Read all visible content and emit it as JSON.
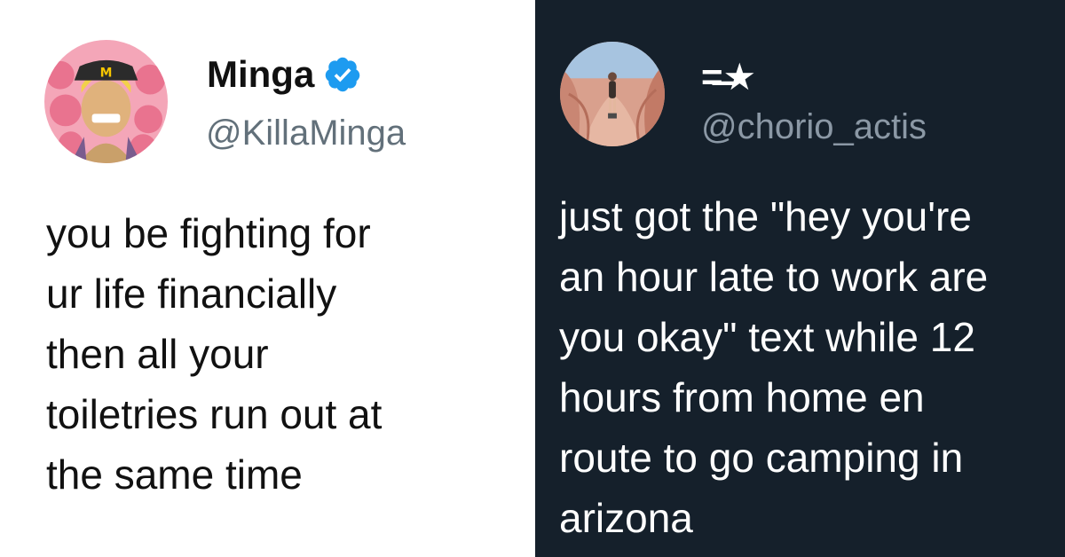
{
  "tweets": [
    {
      "display_name": "Minga",
      "verified": true,
      "handle": "@KillaMinga",
      "text": "you be fighting for\nur life financially\nthen all your\ntoiletries run out at\nthe same time",
      "avatar_icon": "anime-character-avatar-icon",
      "theme": {
        "background": "#ffffff",
        "text": "#111111",
        "handle": "#62707a"
      }
    },
    {
      "display_name": "=̶★",
      "verified": false,
      "handle": "@chorio_actis",
      "text": "just got the \"hey you're\nan hour late to work are\nyou okay\" text while 12\nhours from home en\nroute to go camping in\narizona",
      "avatar_icon": "canyon-photo-avatar-icon",
      "theme": {
        "background": "#15202b",
        "text": "#ffffff",
        "handle": "#8b98a5"
      }
    }
  ],
  "colors": {
    "verified_badge": "#1d9bf0"
  }
}
